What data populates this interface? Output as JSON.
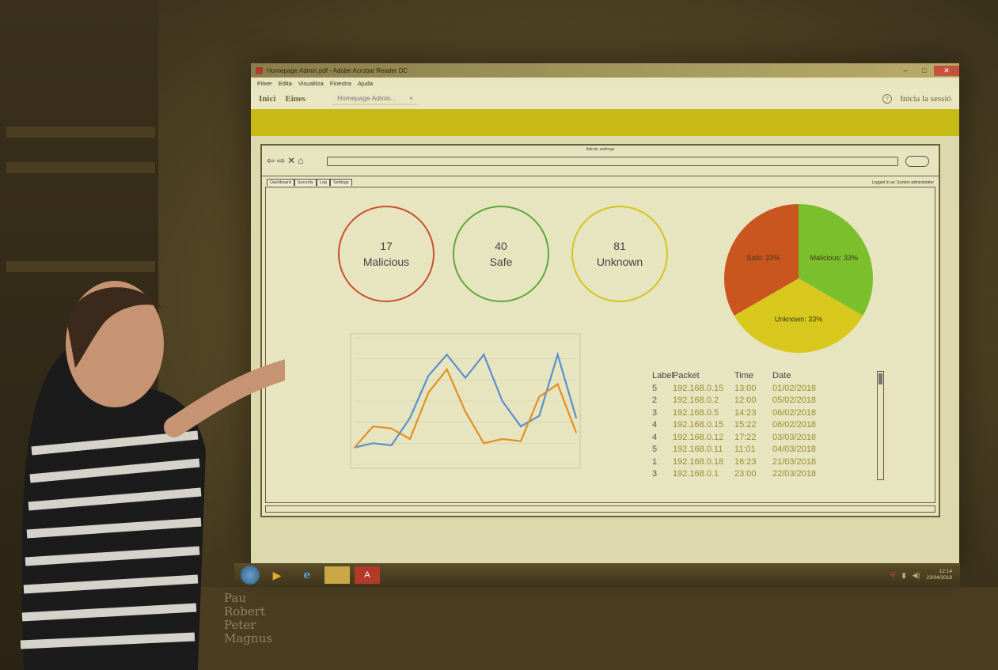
{
  "window": {
    "title": "Homepage Admin.pdf - Adobe Acrobat Reader DC",
    "controls": {
      "minimize": "–",
      "maximize": "□",
      "close": "✕"
    }
  },
  "menu": [
    "Fitxer",
    "Edita",
    "Visualitza",
    "Finestra",
    "Ajuda"
  ],
  "toolbar": {
    "home": "Inici",
    "tools": "Eines",
    "doc_tab": "Homepage Admin...",
    "doc_tab_close": "×",
    "help": "?",
    "signin": "Inicia la sessió"
  },
  "mockup": {
    "title": "Admin settings",
    "tabs": [
      "Dashboard",
      "Security",
      "Log",
      "Settings"
    ],
    "logged_in": "Logged in as: System administrator",
    "stats": [
      {
        "value": "17",
        "label": "Malicious",
        "color": "#c9502e"
      },
      {
        "value": "40",
        "label": "Safe",
        "color": "#5fa83a"
      },
      {
        "value": "81",
        "label": "Unknown",
        "color": "#d6c31c"
      }
    ],
    "table": {
      "headers": [
        "Label",
        "Packet",
        "Time",
        "Date"
      ],
      "rows": [
        [
          "5",
          "192.168.0.15",
          "13:00",
          "01/02/2018"
        ],
        [
          "2",
          "192.168.0.2",
          "12:00",
          "05/02/2018"
        ],
        [
          "3",
          "192.168.0.5",
          "14:23",
          "06/02/2018"
        ],
        [
          "4",
          "192.168.0.15",
          "15:22",
          "06/02/2018"
        ],
        [
          "4",
          "192.168.0.12",
          "17:22",
          "03/03/2018"
        ],
        [
          "5",
          "192.168.0.11",
          "11:01",
          "04/03/2018"
        ],
        [
          "1",
          "192.168.0.18",
          "16:23",
          "21/03/2018"
        ],
        [
          "3",
          "192.168.0.1",
          "23:00",
          "22/03/2018"
        ]
      ]
    }
  },
  "chart_data": [
    {
      "type": "pie",
      "slices": [
        {
          "label": "Malicious: 33%",
          "value": 33.3,
          "color": "#7cbf2c"
        },
        {
          "label": "Unknown: 33%",
          "value": 33.3,
          "color": "#d8c81d"
        },
        {
          "label": "Safe: 33%",
          "value": 33.3,
          "color": "#c9561f"
        }
      ]
    },
    {
      "type": "line",
      "grid": true,
      "x": [
        1,
        2,
        3,
        4,
        5,
        6,
        7,
        8,
        9,
        10,
        11,
        12,
        13
      ],
      "series": [
        {
          "values": [
            0.8,
            1.0,
            0.9,
            2.2,
            4.2,
            5.2,
            4.1,
            5.2,
            3.0,
            1.8,
            2.3,
            5.2,
            2.2
          ],
          "color": "#5b8fd0"
        },
        {
          "values": [
            0.8,
            1.8,
            1.7,
            1.2,
            3.4,
            4.5,
            2.5,
            1.0,
            1.2,
            1.1,
            3.2,
            3.8,
            1.5
          ],
          "color": "#e39022"
        }
      ],
      "ylim": [
        0,
        6
      ]
    }
  ],
  "taskbar": {
    "apps": [
      "ie-icon",
      "folder-icon",
      "acrobat-icon"
    ],
    "time": "12:14",
    "date": "23/04/2018"
  },
  "whiteboard_text": [
    "Pau",
    "Robert",
    "Peter",
    "Magnus"
  ]
}
